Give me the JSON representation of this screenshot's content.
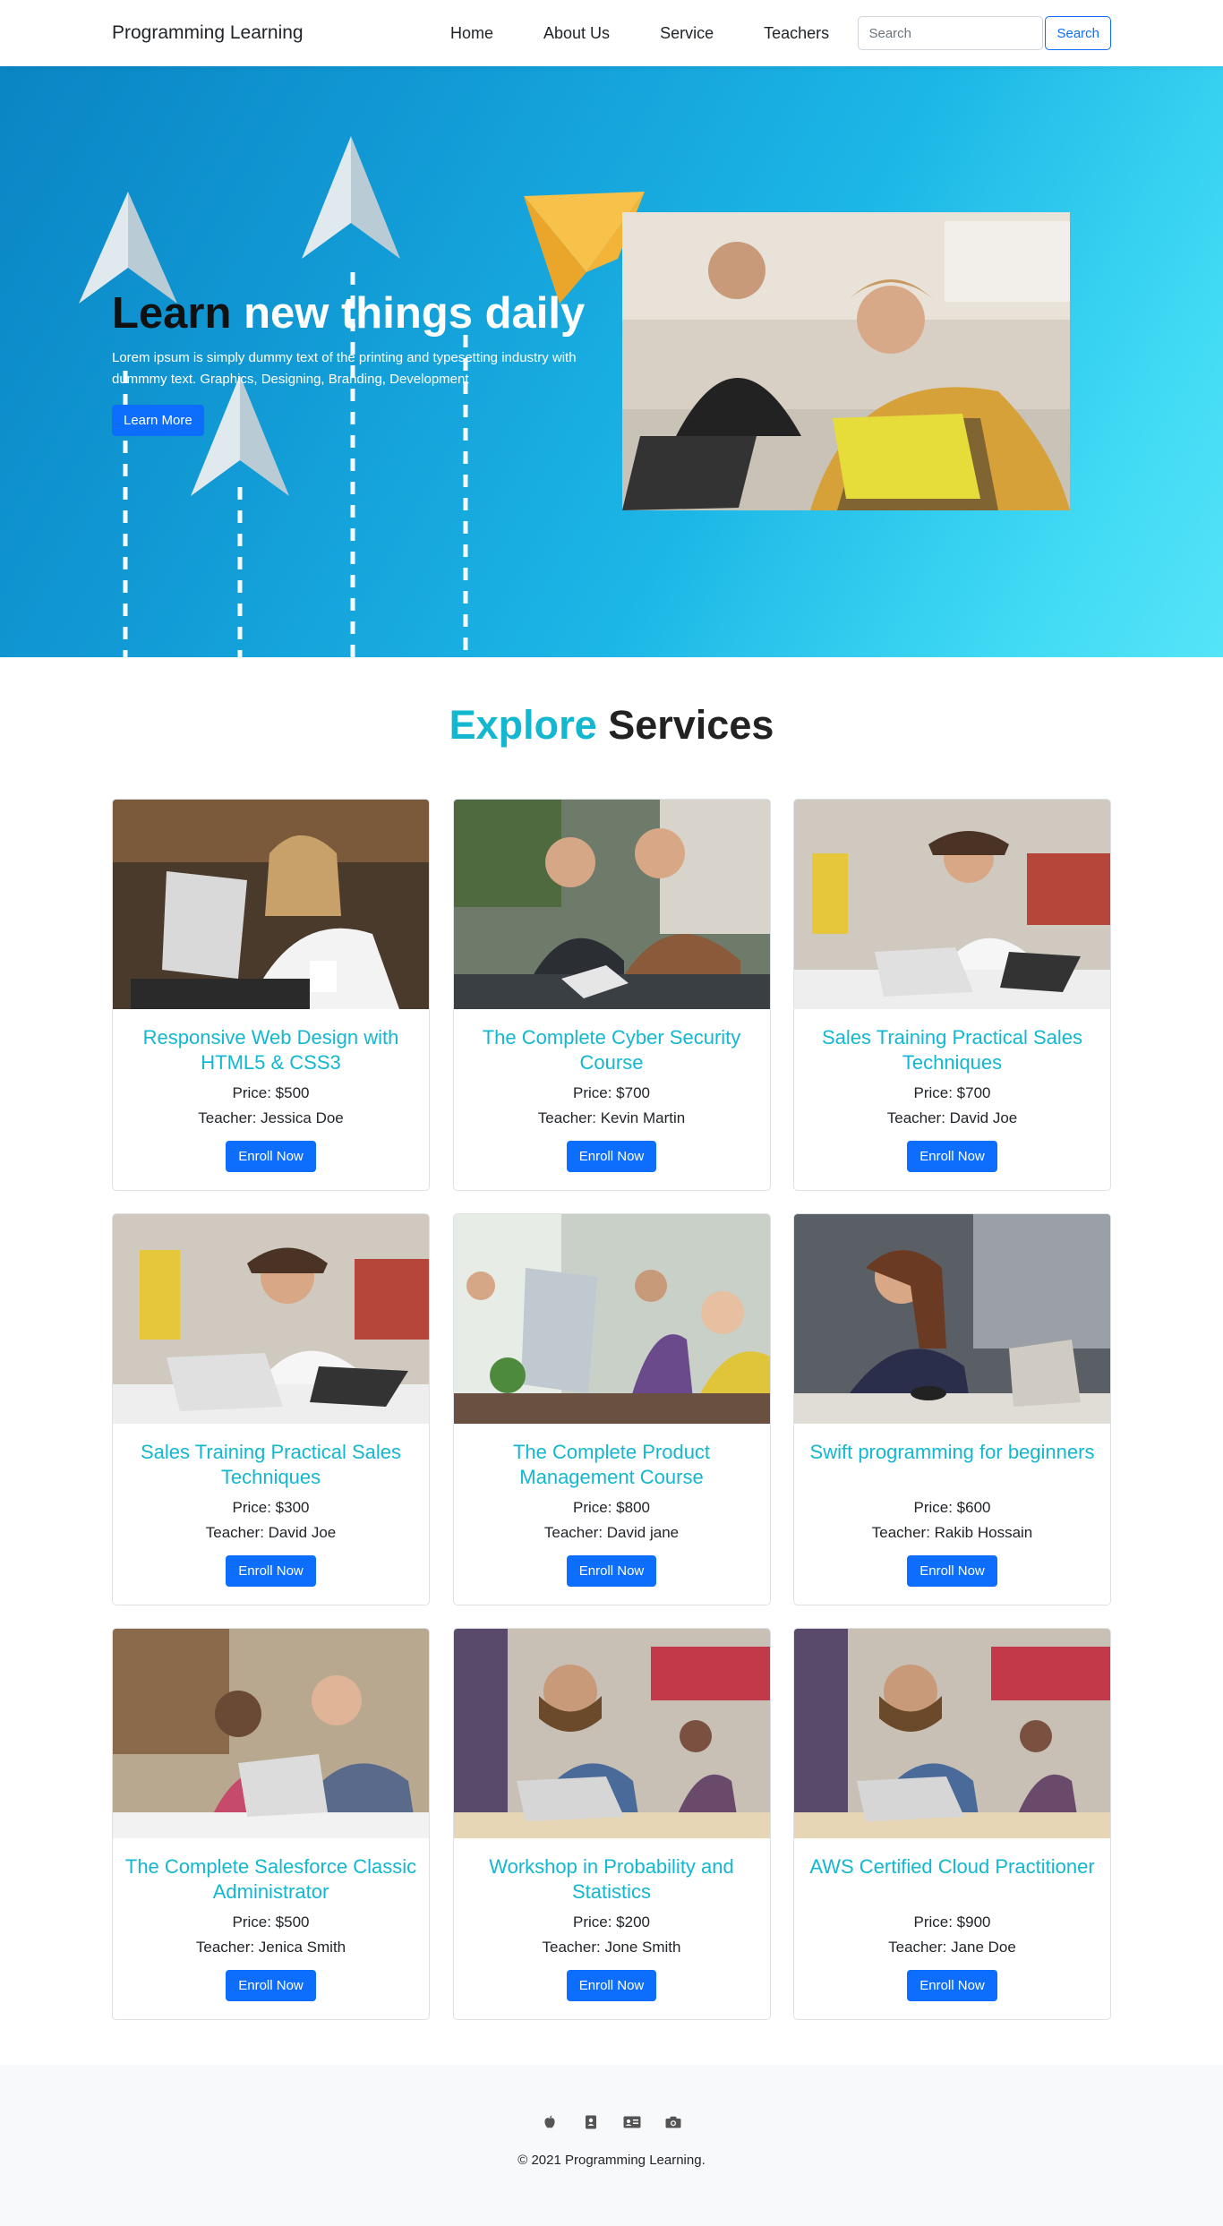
{
  "nav": {
    "brand": "Programming Learning",
    "links": [
      "Home",
      "About Us",
      "Service",
      "Teachers"
    ],
    "search_placeholder": "Search",
    "search_button": "Search"
  },
  "hero": {
    "title_dark": "Learn",
    "title_light": "new things daily",
    "subtitle": "Lorem ipsum is simply dummy text of the printing and typesetting industry with dummmy text. Graphics, Designing, Branding, Development",
    "button": "Learn More"
  },
  "services": {
    "title_accent": "Explore",
    "title_dark": "Services",
    "cards": [
      {
        "title": "Responsive Web Design with HTML5 & CSS3",
        "price": "Price: $500",
        "teacher": "Teacher: Jessica Doe",
        "button": "Enroll Now"
      },
      {
        "title": "The Complete Cyber Security Course",
        "price": "Price: $700",
        "teacher": "Teacher: Kevin Martin",
        "button": "Enroll Now"
      },
      {
        "title": "Sales Training Practical Sales Techniques",
        "price": "Price: $700",
        "teacher": "Teacher: David Joe",
        "button": "Enroll Now"
      },
      {
        "title": "Sales Training Practical Sales Techniques",
        "price": "Price: $300",
        "teacher": "Teacher: David Joe",
        "button": "Enroll Now"
      },
      {
        "title": "The Complete Product Management Course",
        "price": "Price: $800",
        "teacher": "Teacher: David jane",
        "button": "Enroll Now"
      },
      {
        "title": "Swift programming for beginners",
        "price": "Price: $600",
        "teacher": "Teacher: Rakib Hossain",
        "button": "Enroll Now"
      },
      {
        "title": "The Complete Salesforce Classic Administrator",
        "price": "Price: $500",
        "teacher": "Teacher: Jenica Smith",
        "button": "Enroll Now"
      },
      {
        "title": "Workshop in Probability and Statistics",
        "price": "Price: $200",
        "teacher": "Teacher: Jone Smith",
        "button": "Enroll Now"
      },
      {
        "title": "AWS Certified Cloud Practitioner",
        "price": "Price: $900",
        "teacher": "Teacher: Jane Doe",
        "button": "Enroll Now"
      }
    ]
  },
  "footer": {
    "icons": [
      "apple-icon",
      "contact-book-icon",
      "id-card-icon",
      "camera-icon"
    ],
    "copyright": "© 2021 Programming Learning."
  },
  "colors": {
    "accent": "#13b7cf",
    "primary": "#0d6efd",
    "hero_gradient_start": "#0a85c4",
    "hero_gradient_end": "#55e4f8",
    "footer_bg": "#f8f9fa"
  }
}
